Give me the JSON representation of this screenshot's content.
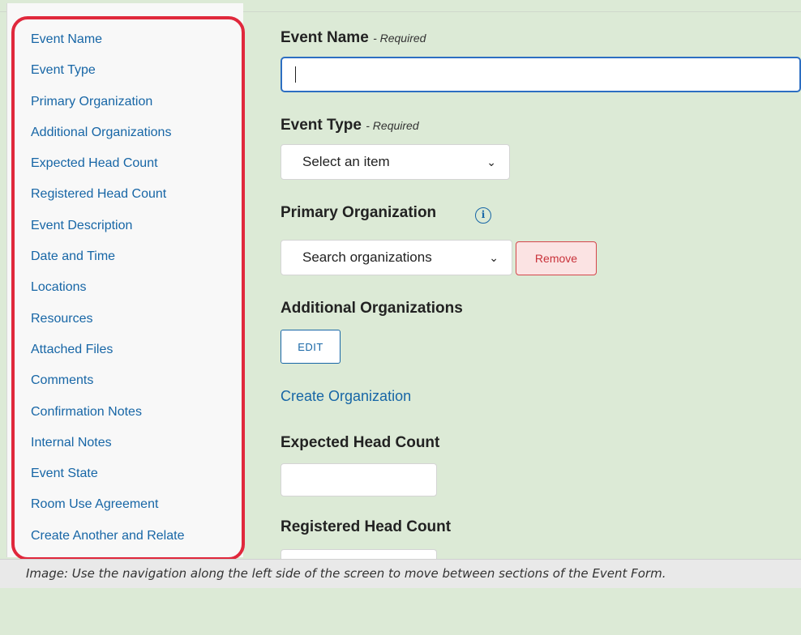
{
  "nav": {
    "items": [
      {
        "label": "Event Name"
      },
      {
        "label": "Event Type"
      },
      {
        "label": "Primary Organization"
      },
      {
        "label": "Additional Organizations"
      },
      {
        "label": "Expected Head Count"
      },
      {
        "label": "Registered Head Count"
      },
      {
        "label": "Event Description"
      },
      {
        "label": "Date and Time"
      },
      {
        "label": "Locations"
      },
      {
        "label": "Resources"
      },
      {
        "label": "Attached Files"
      },
      {
        "label": "Comments"
      },
      {
        "label": "Confirmation Notes"
      },
      {
        "label": "Internal Notes"
      },
      {
        "label": "Event State"
      },
      {
        "label": "Room Use Agreement"
      },
      {
        "label": "Create Another and Relate"
      }
    ],
    "highlight_color": "#e0283c"
  },
  "form": {
    "event_name": {
      "label": "Event Name",
      "required": "- Required",
      "value": ""
    },
    "event_type": {
      "label": "Event Type",
      "required": "- Required",
      "select_value": "Select an item",
      "chevron": "chevron-down-icon"
    },
    "primary_org": {
      "label": "Primary Organization",
      "info_icon": "info-icon",
      "select_value": "Search organizations",
      "remove_label": "Remove"
    },
    "additional_orgs": {
      "label": "Additional Organizations",
      "edit_label": "EDIT"
    },
    "create_org_link": "Create Organization",
    "expected_head_count": {
      "label": "Expected Head Count",
      "value": ""
    },
    "registered_head_count": {
      "label": "Registered Head Count",
      "value": ""
    }
  },
  "caption": "Image: Use the navigation along the left side of the screen to move between sections of the Event Form.",
  "colors": {
    "link": "#1766a6",
    "remove": "#c8323a",
    "focus_border": "#2d6ec2",
    "background": "#dcead6"
  }
}
